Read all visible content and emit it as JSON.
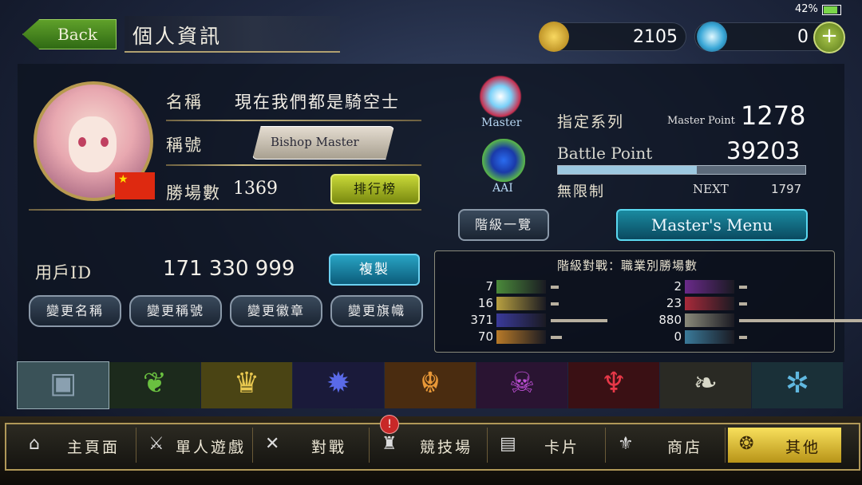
{
  "status": {
    "battery": "42%"
  },
  "header": {
    "back_label": "Back",
    "title": "個人資訊"
  },
  "currency": {
    "gold": "2105",
    "crystal": "0",
    "add_symbol": "+"
  },
  "profile": {
    "name_label": "名稱",
    "name_value": "現在我們都是騎空士",
    "title_label": "稱號",
    "title_badge": "Bishop Master",
    "wins_label": "勝場數",
    "wins_value": "1369",
    "ranking_button": "排行榜",
    "user_id_label": "用戶ID",
    "user_id_value": "171 330 999",
    "copy_button": "複製",
    "change_name": "變更名稱",
    "change_title": "變更稱號",
    "change_emblem": "變更徽章",
    "change_flag": "變更旗幟"
  },
  "rank": {
    "master_label": "Master",
    "aai_label": "AAI",
    "class_label": "指定系列",
    "master_point_label": "Master Point",
    "master_point_value": "1278",
    "battle_point_label": "Battle Point",
    "battle_point_value": "39203",
    "format_label": "無限制",
    "next_label": "NEXT",
    "next_value": "1797",
    "bp_progress": 0.56,
    "rank_list_button": "階級一覽",
    "master_menu_button": "Master's Menu"
  },
  "class_stats": {
    "title": "階級對戰：職業別勝場數",
    "left": [
      {
        "class": "forestcraft",
        "value": "7",
        "color": "#4a8a3a",
        "bar": 0.01
      },
      {
        "class": "swordcraft",
        "value": "16",
        "color": "#b8a040",
        "bar": 0.02
      },
      {
        "class": "runecraft",
        "value": "371",
        "color": "#3a3a9a",
        "bar": 0.42
      },
      {
        "class": "dragoncraft",
        "value": "70",
        "color": "#b87a28",
        "bar": 0.08
      }
    ],
    "right": [
      {
        "class": "shadowcraft",
        "value": "2",
        "color": "#6a2a8a",
        "bar": 0.01
      },
      {
        "class": "bloodcraft",
        "value": "23",
        "color": "#a82a3a",
        "bar": 0.03
      },
      {
        "class": "havencraft",
        "value": "880",
        "color": "#8a8a7a",
        "bar": 1.0
      },
      {
        "class": "portalcraft",
        "value": "0",
        "color": "#3a7a9a",
        "bar": 0.0
      }
    ]
  },
  "class_tabs": [
    {
      "name": "neutral",
      "icon": "▣",
      "color": "#8aa0b0",
      "bg": "#3a5258"
    },
    {
      "name": "forest",
      "icon": "❦",
      "color": "#6ac040",
      "bg": "#1c2a1c"
    },
    {
      "name": "sword",
      "icon": "♛",
      "color": "#e8c850",
      "bg": "#4a4414"
    },
    {
      "name": "rune",
      "icon": "✹",
      "color": "#5a6ae8",
      "bg": "#1a1a3a"
    },
    {
      "name": "dragon",
      "icon": "☬",
      "color": "#e89838",
      "bg": "#4a2c10"
    },
    {
      "name": "shadow",
      "icon": "☠",
      "color": "#c050d8",
      "bg": "#2a1432"
    },
    {
      "name": "blood",
      "icon": "♆",
      "color": "#e83848",
      "bg": "#3a1014"
    },
    {
      "name": "haven",
      "icon": "❧",
      "color": "#d8d8c8",
      "bg": "#2a2a24"
    },
    {
      "name": "portal",
      "icon": "✲",
      "color": "#60b8e0",
      "bg": "#1a3038"
    }
  ],
  "nav": {
    "home": "主頁面",
    "solo": "單人遊戲",
    "battle": "對戰",
    "arena": "競技場",
    "cards": "卡片",
    "shop": "商店",
    "other": "其他",
    "arena_alert": "!"
  }
}
